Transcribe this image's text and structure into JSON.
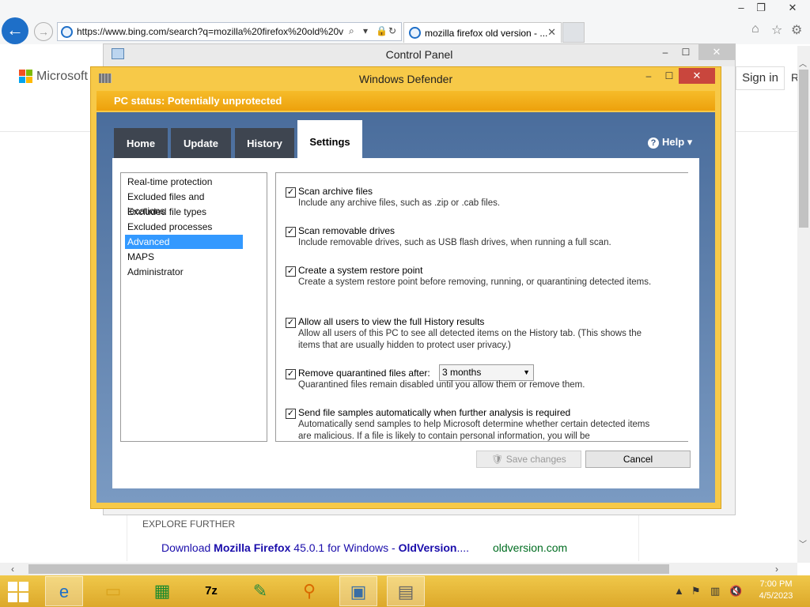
{
  "browser": {
    "url": "https://www.bing.com/search?q=mozilla%20firefox%20old%20v",
    "tab_title": "mozilla firefox old version - ...",
    "tab_close": "✕",
    "back_icon": "back-arrow-icon",
    "forward_icon": "forward-arrow-icon",
    "window_controls": {
      "minimize": "–",
      "restore": "❐",
      "close": "✕"
    },
    "tools": [
      "home-icon",
      "star-icon",
      "gear-icon"
    ]
  },
  "page": {
    "brand": "Microsoft",
    "sign_in": "Sign in",
    "right_letter": "R",
    "explore_further": "EXPLORE FURTHER",
    "result": {
      "prefix": "Download ",
      "bold1": "Mozilla Firefox",
      "mid": " 45.0.1 for Windows - ",
      "bold2": "OldVersion",
      "suffix": "....",
      "site": "oldversion.com"
    }
  },
  "control_panel": {
    "title": "Control Panel",
    "controls": {
      "minimize": "–",
      "maximize": "☐",
      "close": "✕"
    }
  },
  "defender": {
    "title": "Windows Defender",
    "controls": {
      "minimize": "–",
      "maximize": "☐",
      "close": "✕"
    },
    "status": "PC status: Potentially unprotected",
    "tabs": [
      {
        "label": "Home"
      },
      {
        "label": "Update"
      },
      {
        "label": "History"
      },
      {
        "label": "Settings"
      }
    ],
    "active_tab": "Settings",
    "help": "Help",
    "nav": [
      "Real-time protection",
      "Excluded files and locations",
      "Excluded file types",
      "Excluded processes",
      "Advanced",
      "MAPS",
      "Administrator"
    ],
    "selected_nav": "Advanced",
    "options": [
      {
        "title": "Scan archive files",
        "desc": "Include any archive files, such as .zip or .cab files.",
        "checked": true
      },
      {
        "title": "Scan removable drives",
        "desc": "Include removable drives, such as USB flash drives, when running a full scan.",
        "checked": true
      },
      {
        "title": "Create a system restore point",
        "desc": "Create a system restore point before removing, running, or quarantining detected items.",
        "checked": true
      },
      {
        "title": "Allow all users to view the full History results",
        "desc": "Allow all users of this PC to see all detected items on the History tab. (This shows the items that are usually hidden to protect user privacy.)",
        "checked": true
      },
      {
        "title": "Remove quarantined files after:",
        "desc": "Quarantined files remain disabled until you allow them or remove them.",
        "checked": true,
        "select_value": "3 months"
      },
      {
        "title": "Send file samples automatically when further analysis is required",
        "desc": "Automatically send samples to help Microsoft determine whether certain detected items are malicious. If a file is likely to contain personal information, you will be",
        "checked": true
      }
    ],
    "buttons": {
      "save": "Save changes",
      "cancel": "Cancel"
    }
  },
  "taskbar": {
    "items": [
      "internet-explorer-icon",
      "file-explorer-icon",
      "store-icon",
      "7zip-icon",
      "notepad-icon",
      "search-icon",
      "control-panel-icon",
      "windows-defender-icon"
    ],
    "time": "7:00 PM",
    "date": "4/5/2023"
  },
  "colors": {
    "accent_blue": "#1e6fc8",
    "defender_yellow": "#f7c948",
    "status_orange": "#eda10c",
    "selection": "#3399ff",
    "close_red": "#c9463d"
  }
}
